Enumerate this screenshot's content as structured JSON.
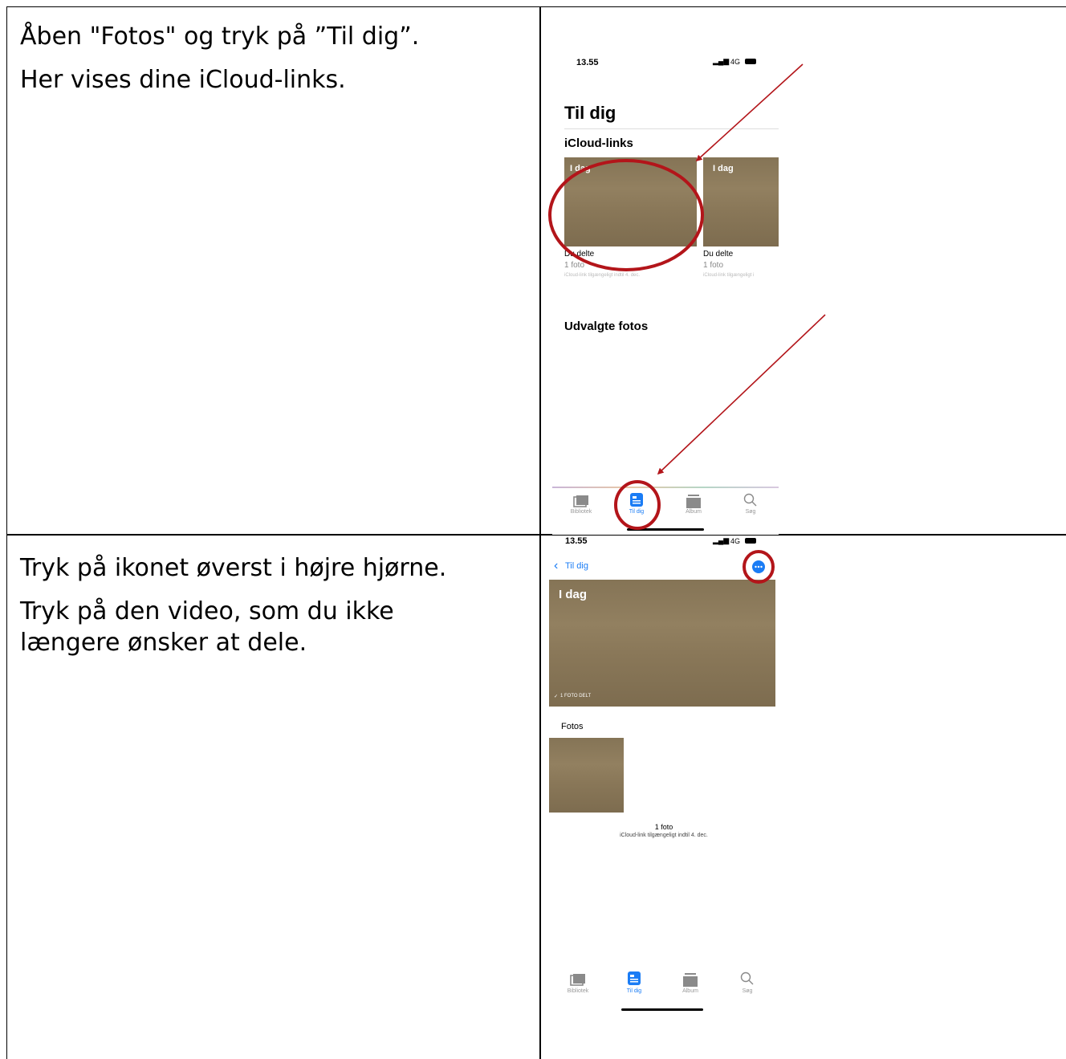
{
  "row1": {
    "instructions": [
      "Åben \"Fotos\" og tryk på ”Til dig”.",
      "Her vises dine iCloud-links."
    ],
    "phone": {
      "time": "13.55",
      "network": "4G",
      "title": "Til dig",
      "section_links": "iCloud-links",
      "card1": {
        "badge": "I dag",
        "caption": "Du delte",
        "count": "1 foto",
        "availability": "iCloud-link tilgængeligt indtil 4. dec."
      },
      "card2": {
        "badge": "I dag",
        "caption": "Du delte",
        "count": "1 foto",
        "availability": "iCloud-link tilgængeligt i"
      },
      "section_featured": "Udvalgte fotos",
      "tabs": [
        "Bibliotek",
        "Til dig",
        "Album",
        "Søg"
      ]
    }
  },
  "row2": {
    "instructions": [
      "Tryk på ikonet øverst i højre hjørne.",
      "Tryk på den video, som du ikke længere ønsker at dele."
    ],
    "phone": {
      "time": "13.55",
      "network": "4G",
      "back_label": "Til dig",
      "hero_badge": "I dag",
      "hero_footer": "1 FOTO DELT",
      "section_photos": "Fotos",
      "count": "1 foto",
      "availability": "iCloud-link tilgængeligt indtil 4. dec.",
      "tabs": [
        "Bibliotek",
        "Til dig",
        "Album",
        "Søg"
      ]
    }
  },
  "colors": {
    "accent": "#1a7cf5",
    "annotation": "#b3151a"
  }
}
